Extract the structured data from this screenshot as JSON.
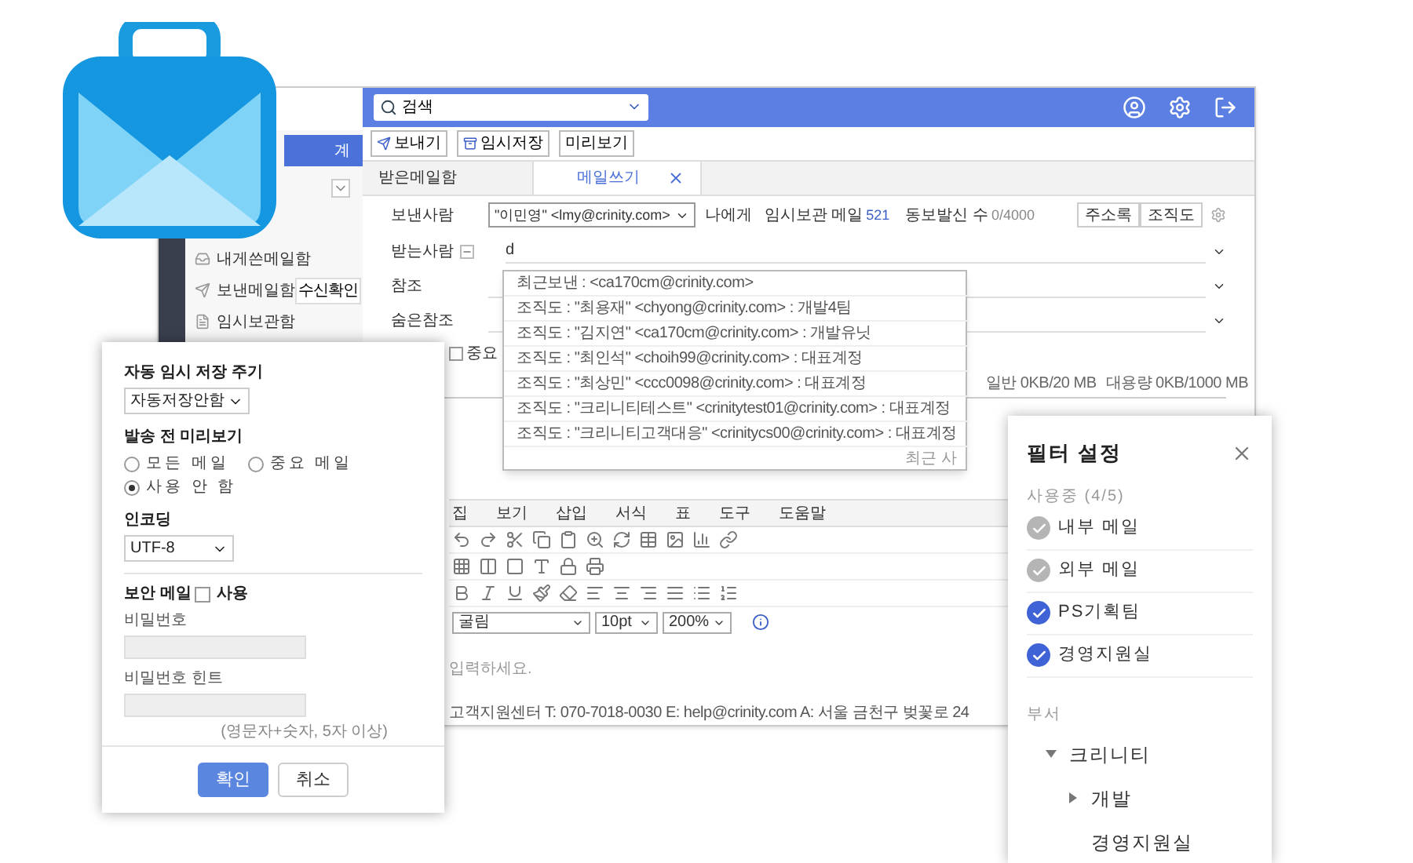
{
  "app_window": {
    "search": {
      "value": "검색"
    },
    "sidebar": {
      "compose_button": "계",
      "items": [
        {
          "label": "내게쓴메일함"
        },
        {
          "label": "보낸메일함",
          "badge": "수신확인"
        },
        {
          "label": "임시보관함"
        }
      ]
    },
    "toolbar": [
      "보내기",
      "임시저장",
      "미리보기"
    ],
    "tabs": [
      {
        "label": "받은메일함",
        "selected": false,
        "closable": false
      },
      {
        "label": "메일쓰기",
        "selected": true,
        "closable": true
      }
    ],
    "compose": {
      "sender_label": "보낸사람",
      "sender": "\"이민영\" <lmy@crinity.com>",
      "to_self": "나에게",
      "draft_label": "임시보관 메일",
      "draft_count": "521",
      "bulk_label": "동보발신 수",
      "bulk_count": "0/4000",
      "address_buttons": [
        "주소록",
        "조직도"
      ],
      "recipient_label": "받는사람",
      "recipient_value": "d",
      "cc_label": "참조",
      "bcc_label": "숨은참조",
      "important_label": "중요",
      "important_checked": false,
      "quota": [
        "일반 0KB/20 MB",
        "대용량 0KB/1000 MB"
      ]
    },
    "autocomplete": {
      "items": [
        "최근보낸 : <ca170cm@crinity.com>",
        "조직도 : \"최용재\" <chyong@crinity.com> : 개발4팀",
        "조직도 : \"김지연\" <ca170cm@crinity.com> : 개발유닛",
        "조직도 : \"최인석\" <choih99@crinity.com> : 대표계정",
        "조직도 : \"최상민\" <ccc0098@crinity.com> : 대표계정",
        "조직도 : \"크리니티테스트\" <crinitytest01@crinity.com> : 대표계정",
        "조직도 : \"크리니티고객대응\" <crinitycs00@crinity.com> : 대표계정"
      ],
      "footer": "최근 사"
    },
    "editor": {
      "menu": [
        "집",
        "보기",
        "삽입",
        "서식",
        "표",
        "도구",
        "도움말"
      ],
      "font": "굴림",
      "size": "10pt",
      "zoom": "200%",
      "placeholder": "입력하세요.",
      "footer": "고객지원센터 T: 070-7018-0030 E: help@crinity.com A: 서울 금천구 벚꽃로 24"
    }
  },
  "settings_dialog": {
    "autosave_label": "자동 임시 저장 주기",
    "autosave_value": "자동저장안함",
    "preview_label": "발송 전 미리보기",
    "preview_options": [
      {
        "label": "모든 메일",
        "selected": false
      },
      {
        "label": "중요 메일",
        "selected": false
      },
      {
        "label": "사용 안 함",
        "selected": true
      }
    ],
    "encoding_label": "인코딩",
    "encoding_value": "UTF-8",
    "secure_label": "보안 메일",
    "secure_option": "사용",
    "secure_checked": false,
    "password_label": "비밀번호",
    "hint_label": "비밀번호 힌트",
    "hint_note": "(영문자+숫자, 5자 이상)",
    "buttons": [
      {
        "label": "확인",
        "kind": "primary"
      },
      {
        "label": "취소",
        "kind": "secondary"
      }
    ]
  },
  "filter_panel": {
    "title": "필터 설정",
    "in_use_label": "사용중 (4/5)",
    "filters": [
      {
        "label": "내부 메일",
        "checked": true,
        "disabled": true
      },
      {
        "label": "외부 메일",
        "checked": true,
        "disabled": true
      },
      {
        "label": "PS기획팀",
        "checked": true,
        "disabled": false
      },
      {
        "label": "경영지원실",
        "checked": true,
        "disabled": false
      }
    ],
    "department_label": "부서",
    "tree": [
      {
        "label": "크리니티",
        "expanded": true,
        "children": [
          {
            "label": "개발",
            "expanded": false
          },
          {
            "label": "경영지원실"
          }
        ]
      }
    ]
  }
}
